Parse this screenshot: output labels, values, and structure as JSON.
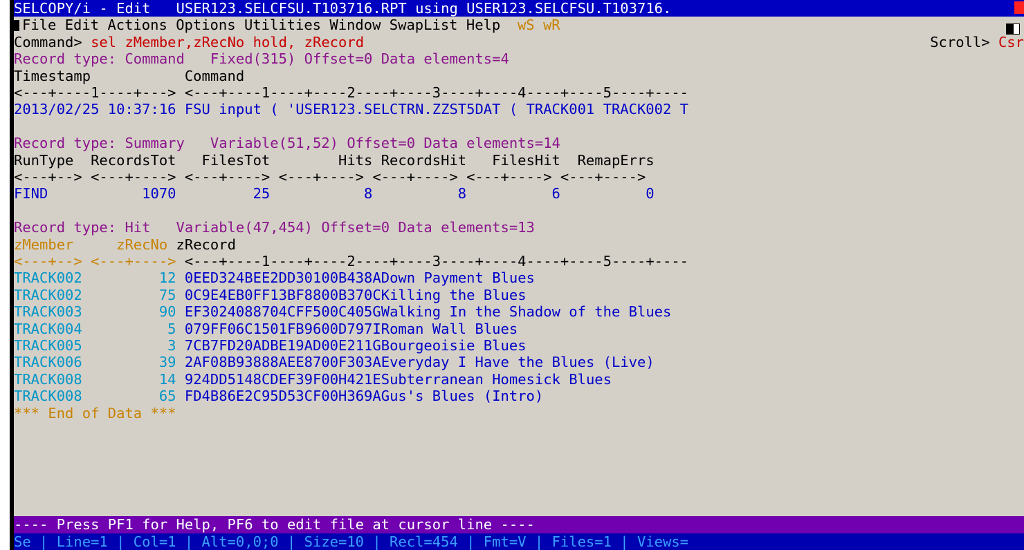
{
  "title_bar": {
    "app": "SELCOPY/i - Edit",
    "file": "USER123.SELCFSU.T103716.RPT using USER123.SELCFSU.T103716."
  },
  "menu_bar": {
    "items": [
      "File",
      "Edit",
      "Actions",
      "Options",
      "Utilities",
      "Window",
      "SwapList",
      "Help"
    ],
    "extra": [
      "wS",
      "wR"
    ]
  },
  "command_line": {
    "label": "Command>",
    "value": "sel zMember,zRecNo hold, zRecord",
    "scroll_label": "Scroll>",
    "scroll_value": "Csr"
  },
  "section_command": {
    "header": "Record type: Command   Fixed(315) Offset=0 Data elements=4",
    "columns": "Timestamp           Command",
    "ruler": "<---+----1----+---> <---+----1----+----2----+----3----+----4----+----5----+----",
    "row": "2013/02/25 10:37:16 FSU input ( 'USER123.SELCTRN.ZZST5DAT ( TRACK001 TRACK002 T"
  },
  "section_summary": {
    "header": "Record type: Summary   Variable(51,52) Offset=0 Data elements=14",
    "columns": "RunType  RecordsTot   FilesTot        Hits RecordsHit   FilesHit  RemapErrs",
    "ruler": "<---+--> <---+----> <---+----> <---+----> <---+----> <---+----> <---+---->",
    "row": "FIND           1070         25           8          8          6          0"
  },
  "section_hit": {
    "header": "Record type: Hit   Variable(47,454) Offset=0 Data elements=13",
    "col_member": "zMember",
    "col_recno": "zRecNo",
    "col_record": "zRecord",
    "ruler_left": "<---+--> <---+---->",
    "ruler_right": "<---+----1----+----2----+----3----+----4----+----5----+----",
    "rows": [
      {
        "member": "TRACK002",
        "recno": "12",
        "record": "0EED324BEE2DD30100B438ADown Payment Blues"
      },
      {
        "member": "TRACK002",
        "recno": "75",
        "record": "0C9E4EB0FF13BF8800B370CKilling the Blues"
      },
      {
        "member": "TRACK003",
        "recno": "90",
        "record": "EF3024088704CFF500C405GWalking In the Shadow of the Blues"
      },
      {
        "member": "TRACK004",
        "recno": "5",
        "record": "079FF06C1501FB9600D797IRoman Wall Blues"
      },
      {
        "member": "TRACK005",
        "recno": "3",
        "record": "7CB7FD20ADBE19AD00E211GBourgeoisie Blues"
      },
      {
        "member": "TRACK006",
        "recno": "39",
        "record": "2AF08B93888AEE8700F303AEveryday I Have the Blues (Live)"
      },
      {
        "member": "TRACK008",
        "recno": "14",
        "record": "924DD5148CDEF39F00H421ESubterranean Homesick Blues"
      },
      {
        "member": "TRACK008",
        "recno": "65",
        "record": "FD4B86E2C95D53CF00H369AGus's Blues (Intro)"
      }
    ],
    "end": "*** End of Data ***"
  },
  "message_bar": "---- Press PF1 for Help, PF6 to edit file at cursor line ----",
  "status_bar": "Se | Line=1 | Col=1 | Alt=0,0;0 | Size=10 | Recl=454 | Fmt=V | Files=1 | Views="
}
